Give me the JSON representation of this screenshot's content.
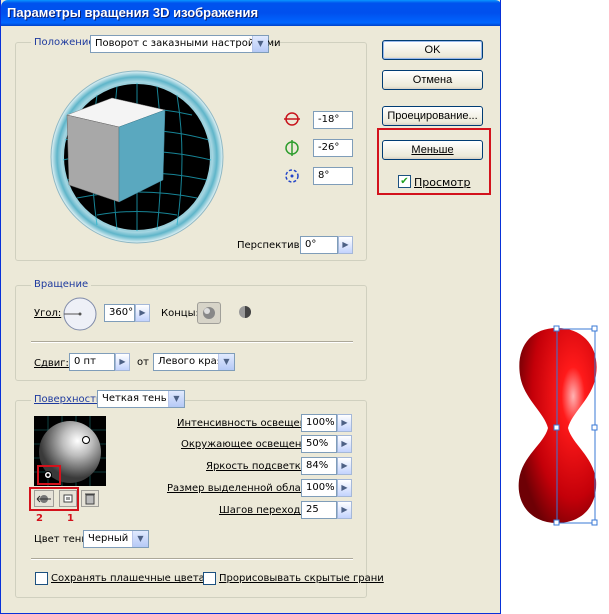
{
  "dialog": {
    "title": "Параметры вращения 3D изображения",
    "buttons": {
      "ok": "OK",
      "cancel": "Отмена",
      "map": "Проецирование...",
      "fewer": "Меньше"
    },
    "preview_label": "Просмотр",
    "preview_checked": true
  },
  "position": {
    "legend": "Положение:",
    "preset": "Поворот с заказными настройками",
    "rot_x": "-18°",
    "rot_y": "-26°",
    "rot_z": "8°",
    "perspective_label": "Перспектива:",
    "perspective": "0°"
  },
  "extrude": {
    "legend": "Вращение",
    "angle_label": "Угол:",
    "angle": "360°",
    "cap_label": "Концы:",
    "offset_label": "Сдвиг:",
    "offset": "0 пт",
    "from_label": "от",
    "from_value": "Левого края"
  },
  "surface": {
    "legend": "Поверхность:",
    "type": "Четкая тень",
    "intensity_label": "Интенсивность освещения:",
    "intensity": "100%",
    "ambient_label": "Окружающее освещение:",
    "ambient": "50%",
    "highlight_label": "Яркость подсветки:",
    "highlight": "84%",
    "size_label": "Размер выделенной области:",
    "size": "100%",
    "steps_label": "Шагов перехода:",
    "steps": "25",
    "shade_label": "Цвет тени:",
    "shade": "Черный",
    "marker1": "1",
    "marker2": "2"
  },
  "options": {
    "preserve_spot": "Сохранять плашечные цвета",
    "draw_hidden": "Прорисовывать скрытые грани"
  },
  "colors": {
    "accent": "#d3121c",
    "cube_front": "#5aa8bf",
    "shape": "#e3000f"
  }
}
